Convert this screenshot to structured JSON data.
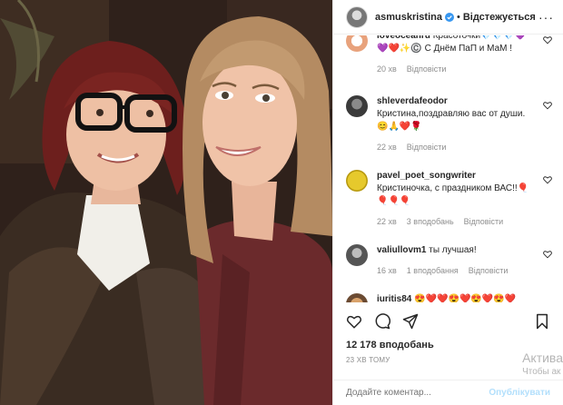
{
  "header": {
    "username": "asmuskristina",
    "separator": "•",
    "follow_label": "Відстежується",
    "more_label": "···"
  },
  "comments": [
    {
      "username": "loveoceanru",
      "text": "Красоточки💎💎💎💜💜❤️✨©️ С Днём ПаП и МаМ !",
      "time": "20 хв",
      "likes": "",
      "reply": "Відповісти"
    },
    {
      "username": "shleverdafeodor",
      "text": "Кристина,поздравляю вас от души.😊🙏❤️🌹",
      "time": "22 хв",
      "likes": "",
      "reply": "Відповісти"
    },
    {
      "username": "pavel_poet_songwriter",
      "text": "Кристиночка, с праздником ВАС!!🎈🎈🎈🎈",
      "time": "22 хв",
      "likes": "3 вподобань",
      "reply": "Відповісти"
    },
    {
      "username": "valiullovm1",
      "text": "ты лучшая!",
      "time": "16 хв",
      "likes": "1 вподобання",
      "reply": "Відповісти"
    },
    {
      "username": "iuritis84",
      "text": "😍❤️❤️😍❤️😍❤️😍❤️",
      "time": "",
      "likes": "",
      "reply": ""
    }
  ],
  "post": {
    "likes_label": "12 178 вподобань",
    "time_label": "23 ХВ ТОМУ",
    "add_comment_placeholder": "Додайте коментар...",
    "publish_label": "Опублікувати"
  },
  "watermark": {
    "line1": "Актива",
    "line2": "Чтобы ак"
  },
  "icons": [
    "verified-icon",
    "more-icon",
    "heart-icon",
    "comment-icon",
    "share-icon",
    "bookmark-icon"
  ],
  "colors": {
    "verified": "#3897f0",
    "muted": "#8e8e8e",
    "publish": "#b2dffc",
    "text": "#262626"
  }
}
